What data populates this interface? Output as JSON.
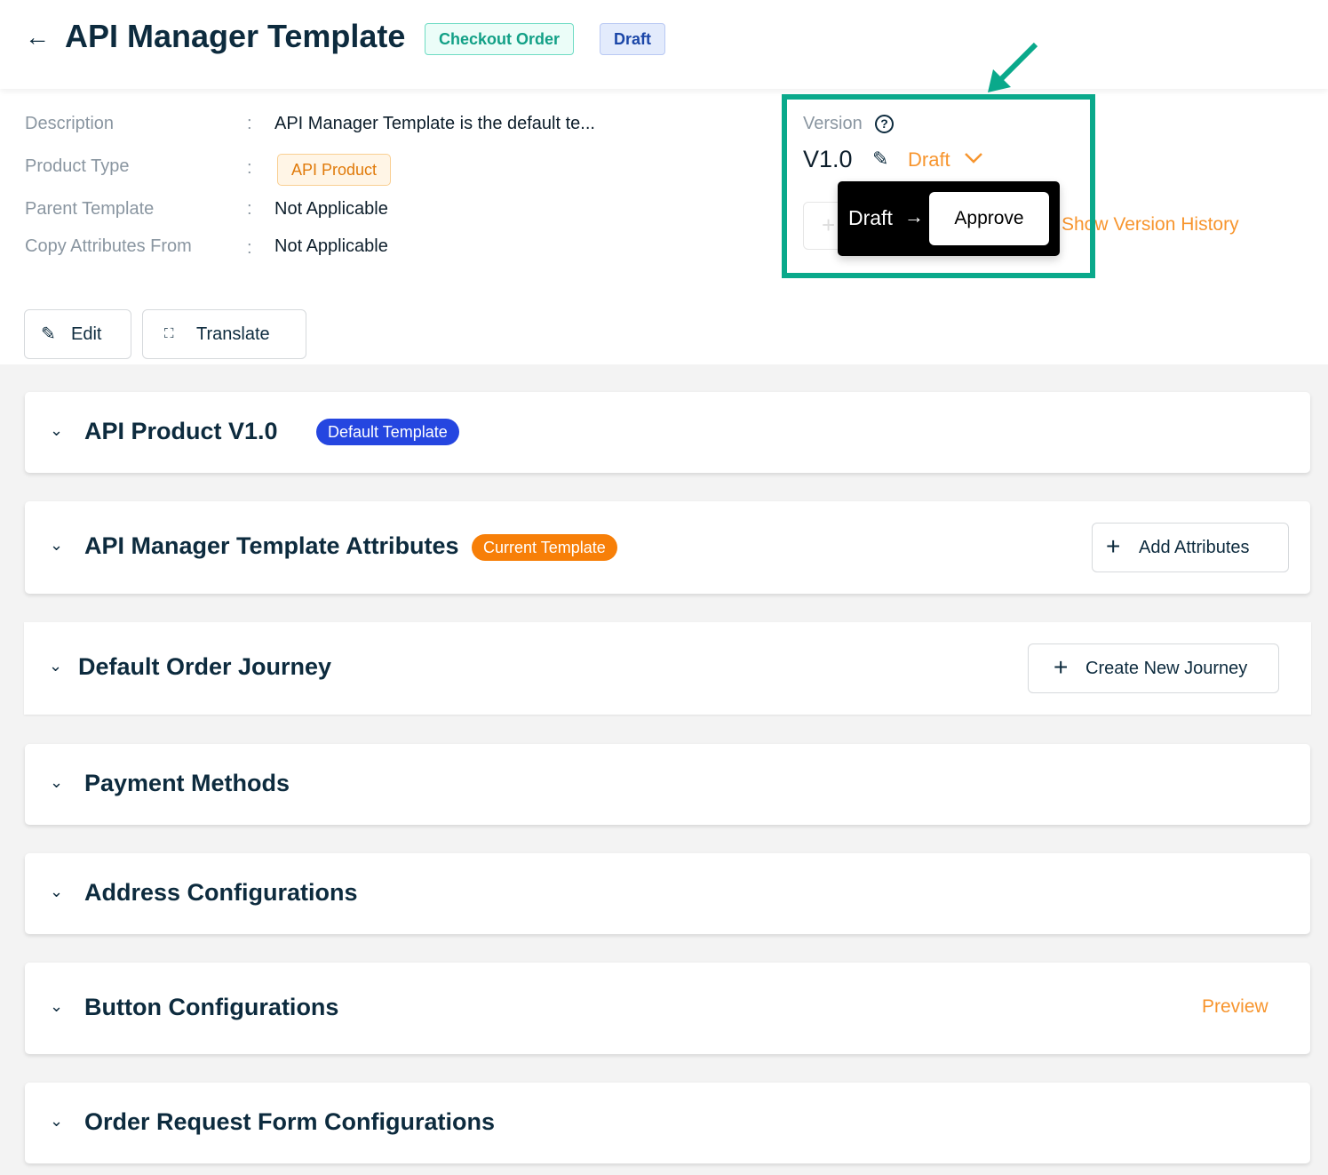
{
  "header": {
    "title": "API Manager Template",
    "category_tag": "Checkout Order",
    "status_tag": "Draft"
  },
  "details": [
    {
      "label": "Description",
      "value": "API Manager Template is the default te..."
    },
    {
      "label": "Product Type",
      "value": "API Product"
    },
    {
      "label": "Parent Template",
      "value": "Not Applicable"
    },
    {
      "label": "Copy Attributes From",
      "value": "Not Applicable"
    }
  ],
  "colon": ":",
  "actions": {
    "edit": "Edit",
    "translate": "Translate"
  },
  "version": {
    "label": "Version",
    "value": "V1.0",
    "status": "Draft",
    "popup_from": "Draft",
    "popup_action": "Approve",
    "history_link": "Show Version History"
  },
  "sections": [
    {
      "title": "API Product V1.0",
      "badge": "Default Template",
      "badge_color": "#2546e0"
    },
    {
      "title": "API Manager Template Attributes",
      "badge": "Current Template",
      "badge_color": "#f77f08",
      "action": "Add Attributes"
    },
    {
      "title": "Default Order Journey",
      "action": "Create New Journey"
    },
    {
      "title": "Payment Methods"
    },
    {
      "title": "Address Configurations"
    },
    {
      "title": "Button Configurations",
      "link": "Preview"
    },
    {
      "title": "Order Request Form Configurations"
    }
  ],
  "colors": {
    "accent_orange": "#f7952e",
    "highlight_green": "#0aa98b",
    "text_dark": "#0d2b3e"
  }
}
